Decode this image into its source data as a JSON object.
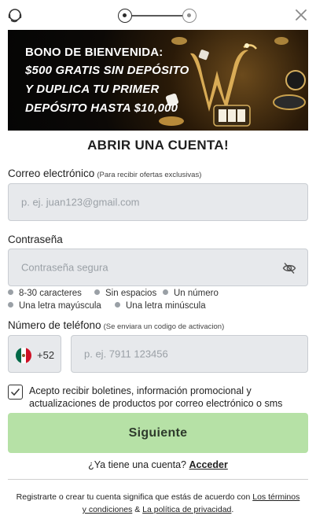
{
  "banner": {
    "line1": "BONO DE BIENVENIDA:",
    "line2": "$500 GRATIS SIN DEPÓSITO",
    "line3": "Y DUPLICA TU PRIMER",
    "line4": "DEPÓSITO HASTA $10,000"
  },
  "form": {
    "title": "ABRIR UNA CUENTA!",
    "email": {
      "label": "Correo electrónico",
      "hint": "(Para recibir ofertas exclusivas)",
      "placeholder": "p. ej. juan123@gmail.com"
    },
    "password": {
      "label": "Contraseña",
      "placeholder": "Contraseña segura",
      "rules": [
        "8-30 caracteres",
        "Sin espacios",
        "Un número",
        "Una letra mayúscula",
        "Una letra minúscula"
      ]
    },
    "phone": {
      "label": "Número de teléfono",
      "hint": "(Se enviara un codigo de activacion)",
      "country_code": "+52",
      "placeholder": "p. ej. 7911 123456"
    },
    "consent": "Acepto recibir boletines, información promocional y actualizaciones de productos por correo electrónico o sms",
    "submit_label": "Siguiente"
  },
  "footer": {
    "have_account": "¿Ya tiene una cuenta?",
    "login_link": "Acceder",
    "legal_prefix": "Registrarte o crear tu cuenta significa que estás de acuerdo con",
    "terms_link": "Los términos y condiciones",
    "legal_and": "&",
    "privacy_link": "La política de privacidad",
    "legal_end": "."
  },
  "colors": {
    "primary_button": "#b6e1a6",
    "field_background": "#e7e9ec"
  },
  "icons": [
    "support-icon",
    "close-icon",
    "eye-off-icon",
    "mexico-flag-icon",
    "check-icon"
  ]
}
